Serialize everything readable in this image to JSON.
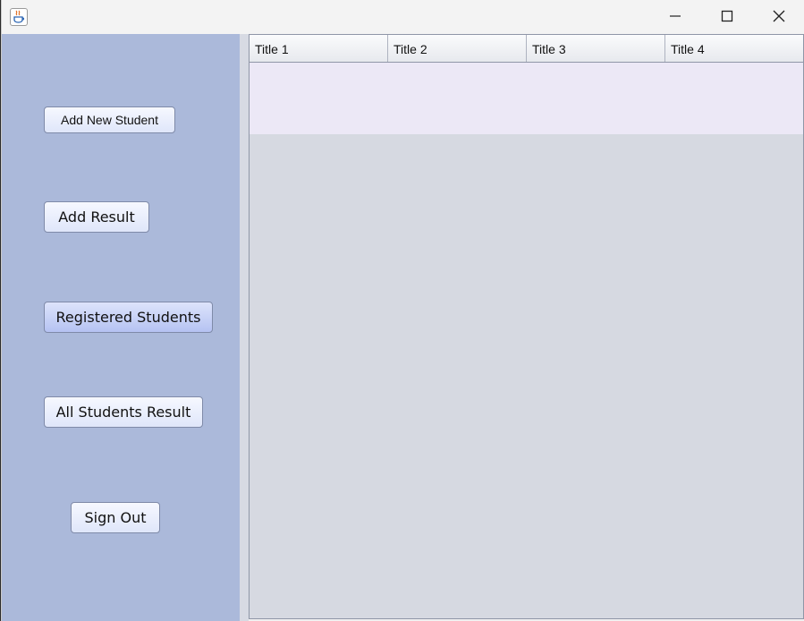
{
  "sidebar": {
    "buttons": {
      "add_new_student": "Add New Student",
      "add_result": "Add Result",
      "registered_students": "Registered Students",
      "all_students_result": "All Students Result",
      "sign_out": "Sign Out"
    }
  },
  "table": {
    "columns": [
      "Title 1",
      "Title 2",
      "Title 3",
      "Title 4"
    ]
  },
  "colors": {
    "sidebar_bg": "#abb9da",
    "table_bg": "#d6d9e1",
    "selected_row_bg": "#ece8f6"
  },
  "icons": {
    "app": "java-cup-icon",
    "minimize": "minimize-icon",
    "maximize": "maximize-icon",
    "close": "close-icon"
  }
}
